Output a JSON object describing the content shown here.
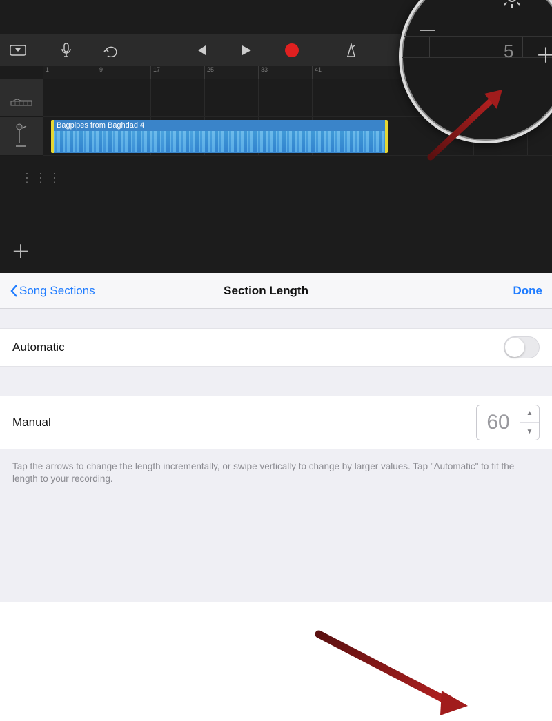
{
  "toolbar": {
    "disclosure_icon": "disclosure-triangle",
    "mic_icon": "microphone",
    "undo_icon": "undo",
    "prev_icon": "skip-back",
    "play_icon": "play",
    "record_icon": "record",
    "metronome_icon": "metronome"
  },
  "ruler_marks": [
    "1",
    "9",
    "17",
    "25",
    "33",
    "41"
  ],
  "tracks": [
    {
      "icon": "piano"
    },
    {
      "icon": "mic-stand",
      "clip_label": "Bagpipes from Baghdad 4"
    }
  ],
  "add_track_icon": "plus",
  "zoom": {
    "gear_icon": "gear",
    "ruler_number": "5",
    "plus_icon": "plus",
    "minus_icon": "minus"
  },
  "settings": {
    "back_label": "Song Sections",
    "title": "Section Length",
    "done_label": "Done",
    "automatic_label": "Automatic",
    "automatic_on": false,
    "manual_label": "Manual",
    "manual_value": "60",
    "help_text": "Tap the arrows to change the length incrementally, or swipe vertically to change by larger values. Tap \"Automatic\" to fit the length to your recording."
  }
}
